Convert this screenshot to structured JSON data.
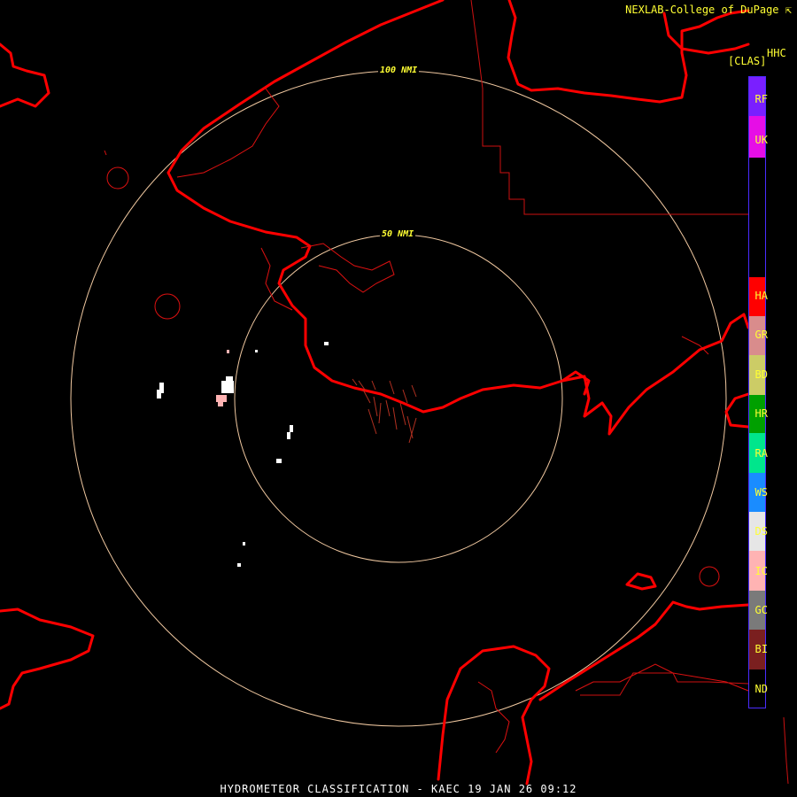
{
  "credit": "NEXLAB-College of DuPage",
  "credit_icon": "cursor-arrow-icon",
  "product_code": "HHC",
  "product_abbr": "[CLAS]",
  "title": "HYDROMETEOR CLASSIFICATION - KAEC 19 JAN 26 09:12",
  "range_rings": [
    {
      "label": "50 NMI"
    },
    {
      "label": "100 NMI"
    }
  ],
  "legend": [
    {
      "code": "RF",
      "color": "#7a1fff"
    },
    {
      "code": "UK",
      "color": "#e60ee6"
    },
    {
      "code": "HA",
      "color": "#ff0000"
    },
    {
      "code": "GR",
      "color": "#d98c8c"
    },
    {
      "code": "BD",
      "color": "#cccc66"
    },
    {
      "code": "HR",
      "color": "#00a000"
    },
    {
      "code": "RA",
      "color": "#00e68c"
    },
    {
      "code": "WS",
      "color": "#1a8cff"
    },
    {
      "code": "DS",
      "color": "#e6e6e6"
    },
    {
      "code": "IC",
      "color": "#ffb3b3"
    },
    {
      "code": "GC",
      "color": "#7a7a7a"
    },
    {
      "code": "BI",
      "color": "#7a1f1f"
    },
    {
      "code": "ND",
      "color": "#000000"
    }
  ],
  "colors": {
    "coastline": "#ff0000",
    "border": "#cc1111",
    "ring": "#f0c8a0",
    "text": "#ffff33"
  }
}
